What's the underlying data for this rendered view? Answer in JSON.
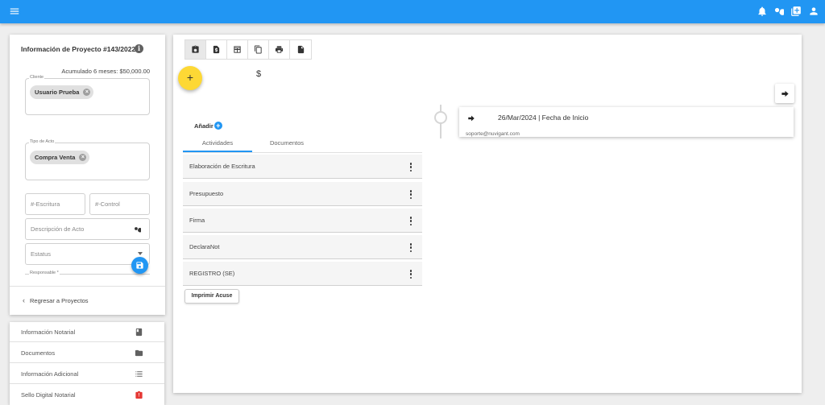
{
  "topbar": {
    "icons": [
      "menu-icon",
      "bell-icon",
      "search-icon",
      "add-box-icon",
      "account-icon"
    ]
  },
  "project_panel": {
    "title": "Información de Proyecto #143/2022",
    "accumulated": "Acumulado 6 meses: $50,000.00",
    "cliente": {
      "label": "Cliente",
      "chip": "Usuario Prueba"
    },
    "tipo_acto": {
      "label": "Tipo de Acto",
      "chip": "Compra Venta"
    },
    "escritura_placeholder": "#-Escritura",
    "control_placeholder": "#-Control",
    "descripcion_placeholder": "Descripción de Acto",
    "estatus_placeholder": "Estatus",
    "responsable_label": "Responsable *",
    "back_label": "Regresar a Proyectos"
  },
  "side_menu": [
    {
      "label": "Información Notarial",
      "icon": "book-icon"
    },
    {
      "label": "Documentos",
      "icon": "folder-icon"
    },
    {
      "label": "Información Adicional",
      "icon": "list-icon"
    },
    {
      "label": "Sello Digital Notarial",
      "icon": "badge-icon",
      "icon_color": "#e53935"
    }
  ],
  "main": {
    "toolbar_icons": [
      "clipboard-icon",
      "file-dollar-icon",
      "table-icon",
      "copy-icon",
      "print-icon",
      "document-icon"
    ],
    "fab_label": "+",
    "currency_symbol": "$",
    "add_label": "Añadir",
    "tabs": [
      {
        "label": "Actividades",
        "active": true
      },
      {
        "label": "Documentos",
        "active": false
      }
    ],
    "activities": [
      "Elaboración de Escritura",
      "Presupuesto",
      "Firma",
      "DeclaraNot",
      "REGISTRO (SE)"
    ],
    "print_button": "Imprimir Acuse"
  },
  "timeline": {
    "entry_title": "26/Mar/2024 | Fecha de Inicio",
    "entry_user": "soporte@nuvigant.com"
  },
  "colors": {
    "primary": "#2196f3",
    "accent_fab": "#fdd835",
    "badge_red": "#e53935"
  }
}
